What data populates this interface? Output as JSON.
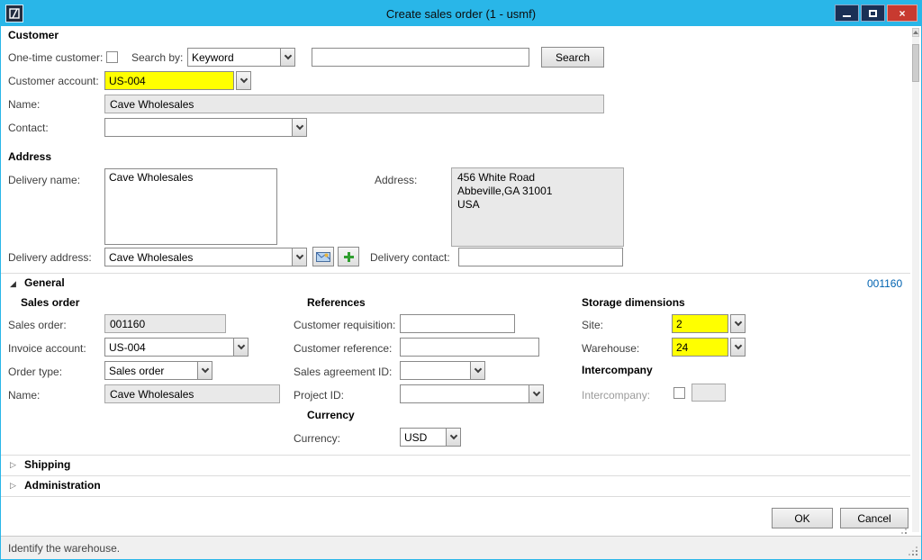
{
  "window": {
    "title": "Create sales order (1 - usmf)"
  },
  "colors": {
    "titlebar": "#29b6e8",
    "highlight": "#ffff00",
    "close_button": "#c83a30",
    "record_link": "#0063b1"
  },
  "customer": {
    "header": "Customer",
    "one_time_customer_label": "One-time customer:",
    "search_by_label": "Search by:",
    "search_by_value": "Keyword",
    "search_button_label": "Search",
    "customer_account_label": "Customer account:",
    "customer_account_value": "US-004",
    "name_label": "Name:",
    "name_value": "Cave Wholesales",
    "contact_label": "Contact:"
  },
  "address": {
    "header": "Address",
    "delivery_name_label": "Delivery name:",
    "delivery_name_value": "Cave Wholesales",
    "address_label": "Address:",
    "address_value": "456 White Road\nAbbeville,GA 31001\nUSA",
    "delivery_address_label": "Delivery address:",
    "delivery_address_value": "Cave Wholesales",
    "delivery_contact_label": "Delivery contact:"
  },
  "general": {
    "header": "General",
    "record_id_link": "001160",
    "sales_order": {
      "header": "Sales order",
      "sales_order_label": "Sales order:",
      "sales_order_value": "001160",
      "invoice_account_label": "Invoice account:",
      "invoice_account_value": "US-004",
      "order_type_label": "Order type:",
      "order_type_value": "Sales order",
      "name_label": "Name:",
      "name_value": "Cave Wholesales"
    },
    "references": {
      "header": "References",
      "customer_requisition_label": "Customer requisition:",
      "customer_reference_label": "Customer reference:",
      "sales_agreement_id_label": "Sales agreement ID:",
      "project_id_label": "Project ID:"
    },
    "currency": {
      "header": "Currency",
      "currency_label": "Currency:",
      "currency_value": "USD"
    },
    "storage_dimensions": {
      "header": "Storage dimensions",
      "site_label": "Site:",
      "site_value": "2",
      "warehouse_label": "Warehouse:",
      "warehouse_value": "24"
    },
    "intercompany": {
      "header": "Intercompany",
      "intercompany_label": "Intercompany:"
    }
  },
  "shipping": {
    "header": "Shipping"
  },
  "administration": {
    "header": "Administration"
  },
  "footer": {
    "ok": "OK",
    "cancel": "Cancel"
  },
  "statusbar": {
    "text": "Identify the warehouse."
  }
}
